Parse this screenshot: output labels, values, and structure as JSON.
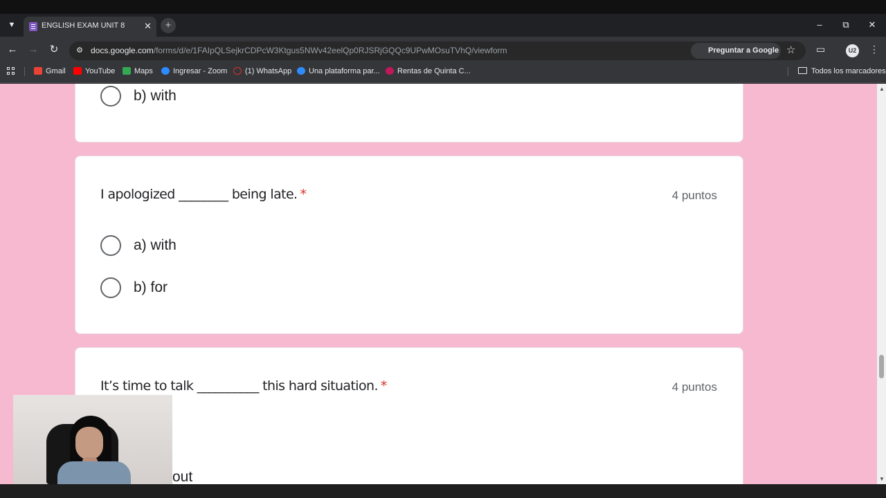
{
  "browser": {
    "tab_title": "ENGLISH EXAM UNIT 8",
    "url_domain": "docs.google.com",
    "url_path": "/forms/d/e/1FAIpQLSejkrCDPcW3Ktgus5NWv42eelQp0RJSRjGQQc9UPwMOsuTVhQ/viewform",
    "ask_google": "Preguntar a Google",
    "profile_initials": "U2"
  },
  "bookmarks": {
    "items": [
      {
        "label": "Gmail",
        "color": "#ea4335"
      },
      {
        "label": "YouTube",
        "color": "#ff0000"
      },
      {
        "label": "Maps",
        "color": "#34a853"
      },
      {
        "label": "Ingresar - Zoom",
        "color": "#2d8cff"
      },
      {
        "label": "(1) WhatsApp",
        "color": "#d93025"
      },
      {
        "label": "Una plataforma par...",
        "color": "#2d8cff"
      },
      {
        "label": "Rentas de Quinta C...",
        "color": "#c2185b"
      }
    ],
    "all_bookmarks": "Todos los marcadores"
  },
  "form": {
    "prev_option": "b) with",
    "q1": {
      "text": "I apologized ________ being late.",
      "required_mark": "*",
      "points": "4 puntos",
      "options": [
        "a) with",
        "b) for"
      ]
    },
    "q2": {
      "text": "It’s time to talk __________ this hard situation.",
      "required_mark": "*",
      "points": "4 puntos",
      "partial_option": "out"
    }
  },
  "colors": {
    "page_background": "#f7b9d0",
    "required": "#d93025"
  }
}
